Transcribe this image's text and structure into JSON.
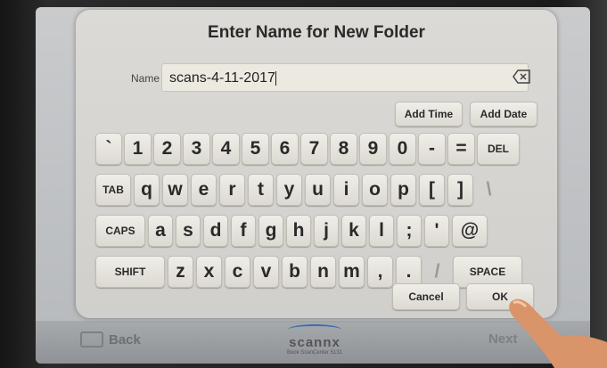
{
  "dialog": {
    "title": "Enter Name for New Folder",
    "name_label": "Name",
    "name_value": "scans-4-11-2017",
    "add_time": "Add Time",
    "add_date": "Add Date",
    "cancel": "Cancel",
    "ok": "OK"
  },
  "keyboard": {
    "row1": [
      "`",
      "1",
      "2",
      "3",
      "4",
      "5",
      "6",
      "7",
      "8",
      "9",
      "0",
      "-",
      "=",
      "DEL"
    ],
    "row2": [
      "TAB",
      "q",
      "w",
      "e",
      "r",
      "t",
      "y",
      "u",
      "i",
      "o",
      "p",
      "[",
      "]",
      "\\"
    ],
    "row3": [
      "CAPS",
      "a",
      "s",
      "d",
      "f",
      "g",
      "h",
      "j",
      "k",
      "l",
      ";",
      "'",
      "@"
    ],
    "row4": [
      "SHIFT",
      "z",
      "x",
      "c",
      "v",
      "b",
      "n",
      "m",
      ",",
      ".",
      "/",
      "SPACE"
    ]
  },
  "footer": {
    "back": "Back",
    "next": "Next",
    "brand": "scannx",
    "model": "Book ScanCenter 5131"
  },
  "colors": {
    "dialog_bg": "#d6d4d0",
    "key_bg": "#e8e6e0",
    "brand_blue": "#3b6fb0"
  }
}
